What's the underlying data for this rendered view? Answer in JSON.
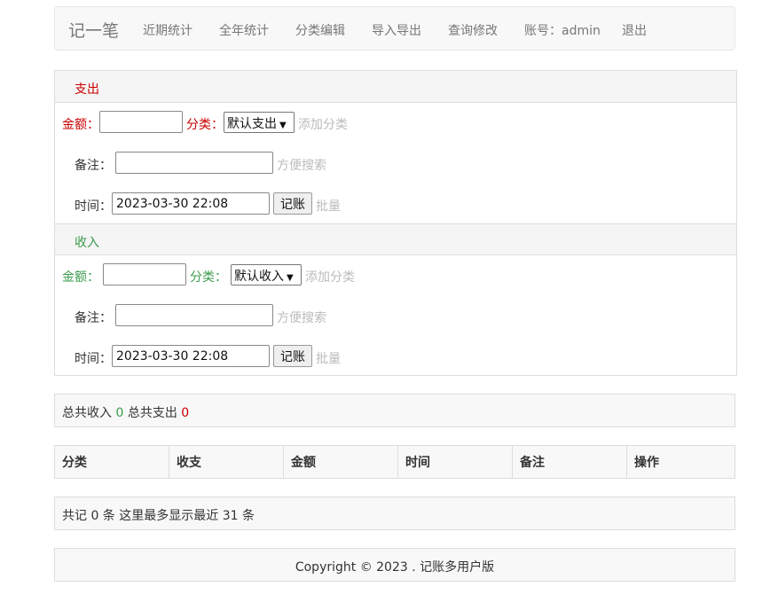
{
  "nav": {
    "brand": "记一笔",
    "links": [
      "近期统计",
      "全年统计",
      "分类编辑",
      "导入导出",
      "查询修改",
      "账号：admin",
      "退出"
    ]
  },
  "expense": {
    "heading": "支出",
    "amount_label": "金额：",
    "category_label": "分类：",
    "category_selected": "默认支出",
    "add_category": "添加分类",
    "note_label": "备注：",
    "note_hint": "方便搜索",
    "time_label": "时间：",
    "time_value": "2023-03-30 22:08",
    "submit": "记账",
    "batch": "批量"
  },
  "income": {
    "heading": "收入",
    "amount_label": "金额：",
    "category_label": "分类：",
    "category_selected": "默认收入",
    "add_category": "添加分类",
    "note_label": "备注：",
    "note_hint": "方便搜索",
    "time_label": "时间：",
    "time_value": "2023-03-30 22:08",
    "submit": "记账",
    "batch": "批量"
  },
  "totals": {
    "income_label": "总共收入",
    "income_value": "0",
    "expense_label": "总共支出",
    "expense_value": "0"
  },
  "table": {
    "headers": [
      "分类",
      "收支",
      "金额",
      "时间",
      "备注",
      "操作"
    ]
  },
  "summary": "共记 0 条 这里最多显示最近 31 条",
  "footer": "Copyright © 2023 . 记账多用户版",
  "colors": {
    "expense": "#cc0000",
    "income": "#3c9b4c",
    "muted": "#bbbbbb"
  }
}
